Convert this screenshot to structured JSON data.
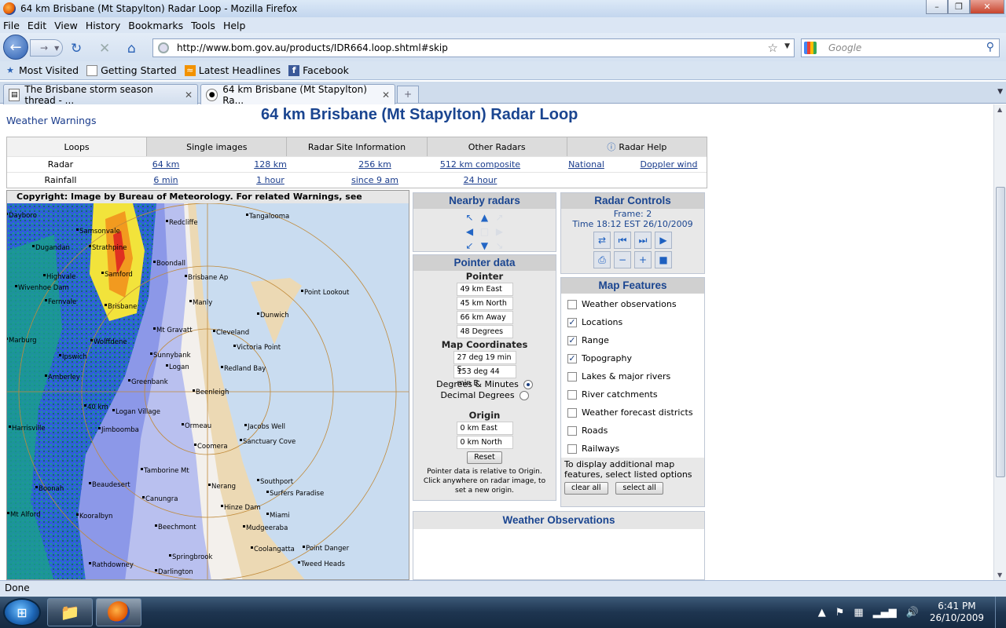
{
  "window": {
    "title": "64 km Brisbane (Mt Stapylton) Radar Loop - Mozilla Firefox"
  },
  "menu": [
    "File",
    "Edit",
    "View",
    "History",
    "Bookmarks",
    "Tools",
    "Help"
  ],
  "url": "http://www.bom.gov.au/products/IDR664.loop.shtml#skip",
  "search_placeholder": "Google",
  "bookmarks": [
    "Most Visited",
    "Getting Started",
    "Latest Headlines",
    "Facebook"
  ],
  "tabs": [
    {
      "label": "The Brisbane storm season thread - ..."
    },
    {
      "label": "64 km Brisbane (Mt Stapylton) Ra..."
    }
  ],
  "status": "Done",
  "clock": {
    "time": "6:41 PM",
    "date": "26/10/2009"
  },
  "page": {
    "warnings_link": "Weather Warnings",
    "title": "64 km Brisbane (Mt Stapylton) Radar Loop",
    "nav_tabs": [
      "Loops",
      "Single images",
      "Radar Site Information",
      "Other Radars",
      "Radar Help"
    ],
    "radar_row": {
      "label": "Radar",
      "links": [
        "64 km",
        "128 km",
        "256 km",
        "512 km composite",
        "National",
        "Doppler wind"
      ]
    },
    "rainfall_row": {
      "label": "Rainfall",
      "links": [
        "6 min",
        "1 hour",
        "since 9 am",
        "24 hour"
      ]
    },
    "copyright": "Copyright: Image by Bureau of Meteorology. For related Warnings, see www.bom.gov.au",
    "map_labels": [
      "Dayboro",
      "Samsonvale",
      "Redcliffe",
      "Tangalooma",
      "Dugandan",
      "Strathpine",
      "Boondall",
      "Highvale",
      "Brisbane Ap",
      "Point Lookout",
      "Wivenhoe Dam",
      "Samford",
      "Manly",
      "Fernvale",
      "Brisbane",
      "Dunwich",
      "Mt Gravatt",
      "Cleveland",
      "Marburg",
      "Wolffdene",
      "Victoria Point",
      "Ipswich",
      "Sunnybank",
      "Logan",
      "Amberley",
      "Redland Bay",
      "Greenbank",
      "Beenleigh",
      "Harrisville",
      "Logan Village",
      "40 km",
      "Jimboomba",
      "Ormeau",
      "Jacobs Well",
      "Coomera",
      "Sanctuary Cove",
      "Tamborine Mt",
      "Boonah",
      "Beaudesert",
      "Canungra",
      "Nerang",
      "Southport",
      "Surfers Paradise",
      "Mt Alford",
      "Kooralbyn",
      "Hinze Dam",
      "Miami",
      "Beechmont",
      "Mudgeeraba",
      "Coolangatta",
      "Point Danger",
      "Springbrook",
      "Rathdowney",
      "Darlington",
      "Tweed Heads"
    ],
    "nearby": {
      "title": "Nearby radars"
    },
    "pointer": {
      "title": "Pointer data",
      "sub1": "Pointer",
      "values": [
        "49 km East",
        "45 km North",
        "66 km Away",
        "48 Degrees"
      ],
      "sub2": "Map Coordinates",
      "coords": [
        "27 deg 19 min S",
        "153 deg 44 min E"
      ],
      "opt1": "Degrees & Minutes",
      "opt2": "Decimal Degrees",
      "sub3": "Origin",
      "origin": [
        "0 km East",
        "0 km North"
      ],
      "reset": "Reset",
      "note": "Pointer data is relative to Origin. Click anywhere on radar image, to set a new origin."
    },
    "controls": {
      "title": "Radar Controls",
      "frame": "Frame: 2",
      "time": "Time 18:12 EST 26/10/2009"
    },
    "features": {
      "title": "Map Features",
      "items": [
        {
          "label": "Weather observations",
          "checked": false
        },
        {
          "label": "Locations",
          "checked": true
        },
        {
          "label": "Range",
          "checked": true
        },
        {
          "label": "Topography",
          "checked": true
        },
        {
          "label": "Lakes & major rivers",
          "checked": false
        },
        {
          "label": "River catchments",
          "checked": false
        },
        {
          "label": "Weather forecast districts",
          "checked": false
        },
        {
          "label": "Roads",
          "checked": false
        },
        {
          "label": "Railways",
          "checked": false
        }
      ],
      "note": "To display additional map features, select listed options",
      "clear": "clear all",
      "select": "select all"
    },
    "observations": {
      "title": "Weather Observations"
    }
  }
}
